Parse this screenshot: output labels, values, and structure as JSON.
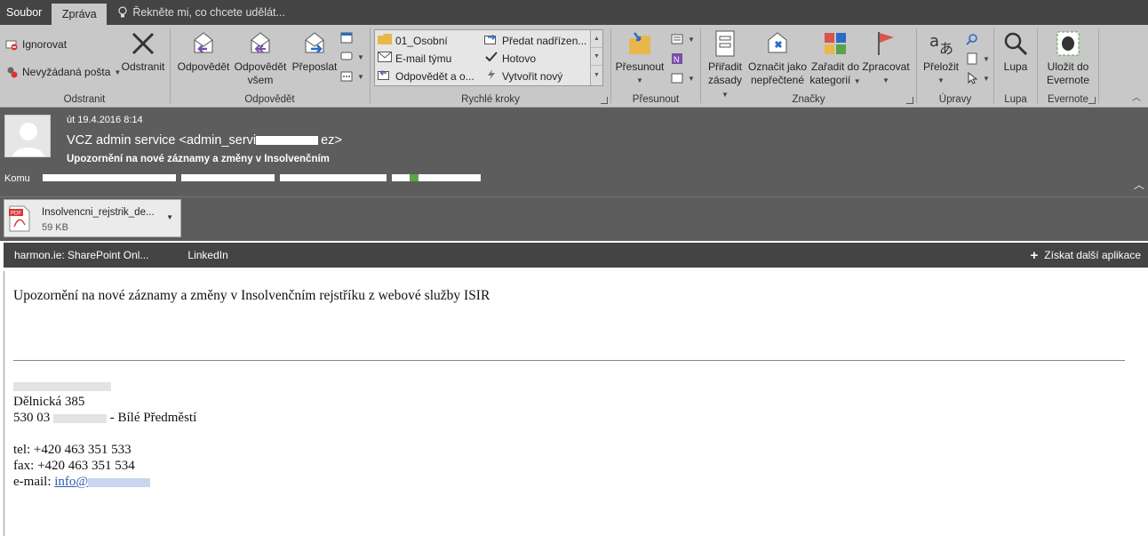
{
  "tabs": {
    "file": "Soubor",
    "message": "Zpráva",
    "tell_me": "Řekněte mi, co chcete udělát..."
  },
  "ribbon": {
    "odstranit": {
      "ignore": "Ignorovat",
      "junk": "Nevyžádaná pošta",
      "delete": "Odstranit",
      "label": "Odstranit"
    },
    "respond": {
      "reply": "Odpovědět",
      "reply_all_1": "Odpovědět",
      "reply_all_2": "všem",
      "forward": "Přeposlat",
      "label": "Odpovědět"
    },
    "quick_steps": {
      "items": [
        "01_Osobní",
        "E-mail týmu",
        "Odpovědět a o...",
        "Předat nadřízen...",
        "Hotovo",
        "Vytvořit nový"
      ],
      "label": "Rychlé kroky"
    },
    "move": {
      "move": "Přesunout",
      "label": "Přesunout"
    },
    "tags": {
      "assign_1": "Přiřadit",
      "assign_2": "zásady",
      "mark_1": "Označit jako",
      "mark_2": "nepřečtené",
      "categorize_1": "Zařadit do",
      "categorize_2": "kategorií",
      "followup": "Zpracovat",
      "label": "Značky"
    },
    "editing": {
      "translate": "Přeložit",
      "label": "Úpravy"
    },
    "zoom": {
      "zoom": "Lupa",
      "label": "Lupa"
    },
    "evernote": {
      "save_1": "Uložit do",
      "save_2": "Evernote",
      "label": "Evernote"
    }
  },
  "message": {
    "date": "út 19.4.2016 8:14",
    "sender": "VCZ admin service <admin_servi",
    "sender_tail": "ez>",
    "subject": "Upozornění na nové záznamy a změny v Insolvenčním",
    "to_label": "Komu"
  },
  "attachment": {
    "name": "Insolvencni_rejstrik_de...",
    "size": "59 KB"
  },
  "addins": {
    "items": [
      "harmon.ie: SharePoint Onl...",
      "LinkedIn"
    ],
    "get_more": "Získat další aplikace"
  },
  "body": {
    "main_text": "Upozornění na nové záznamy a změny v Insolvenčním rejstříku z webové služby ISIR",
    "sig_street": "Dělnická 385",
    "sig_city_prefix": "530 03",
    "sig_city_suffix": "- Bílé Předměstí",
    "sig_tel": "tel: +420 463 351 533",
    "sig_fax": "fax: +420 463 351 534",
    "sig_mail_label": "e-mail:",
    "sig_mail": "info@"
  },
  "colors": {
    "titlebar": "#444444",
    "ribbon": "#c8c8c8",
    "header": "#5d5d5d",
    "accent_purple": "#7b4fa8",
    "accent_blue": "#2b6cc4",
    "flag_red": "#d9534f"
  }
}
